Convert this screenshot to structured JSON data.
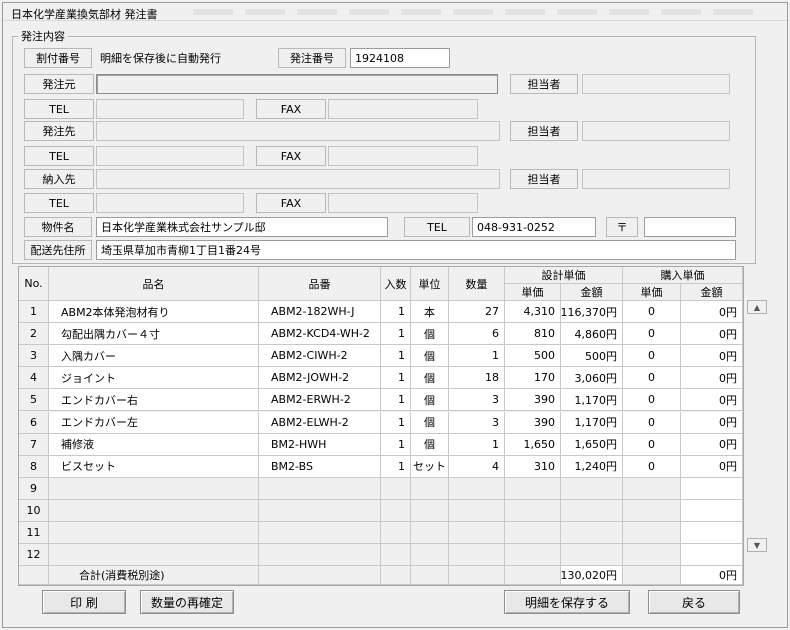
{
  "window": {
    "title": "日本化学産業換気部材 発注書"
  },
  "order_info": {
    "legend": "発注内容",
    "wari_no_label": "割付番号",
    "wari_no_value": "明細を保存後に自動発行",
    "order_no_label": "発注番号",
    "order_no_value": "1924108",
    "from_label": "発注元",
    "from_value": "",
    "from_person_label": "担当者",
    "from_person_value": "",
    "from_tel_label": "TEL",
    "from_tel_value": "",
    "from_fax_label": "FAX",
    "from_fax_value": "",
    "to_label": "発注先",
    "to_value": "",
    "to_person_label": "担当者",
    "to_person_value": "",
    "to_tel_label": "TEL",
    "to_tel_value": "",
    "to_fax_label": "FAX",
    "to_fax_value": "",
    "deliver_label": "納入先",
    "deliver_value": "",
    "deliver_person_label": "担当者",
    "deliver_person_value": "",
    "deliver_tel_label": "TEL",
    "deliver_tel_value": "",
    "deliver_fax_label": "FAX",
    "deliver_fax_value": "",
    "property_label": "物件名",
    "property_value": "日本化学産業株式会社サンプル邸",
    "property_tel_label": "TEL",
    "property_tel_value": "048-931-0252",
    "postal_label": "〒",
    "postal_value": "",
    "address_label": "配送先住所",
    "address_value": "埼玉県草加市青柳1丁目1番24号"
  },
  "table": {
    "headers": {
      "no": "No.",
      "name": "品名",
      "code": "品番",
      "qty_per": "入数",
      "unit": "単位",
      "qty": "数量",
      "design_price": "設計単価",
      "unit_price": "単価",
      "amount": "金額",
      "purchase_price": "購入単価",
      "p_unit_price": "単価",
      "p_amount": "金額"
    },
    "rows": [
      {
        "no": "1",
        "name": "ABM2本体発泡材有り",
        "code": "ABM2-182WH-J",
        "qty_per": "1",
        "unit": "本",
        "qty": "27",
        "price": "4,310",
        "amount": "116,370円",
        "p_price": "0",
        "p_amount": "0円"
      },
      {
        "no": "2",
        "name": "勾配出隅カバー４寸",
        "code": "ABM2-KCD4-WH-2",
        "qty_per": "1",
        "unit": "個",
        "qty": "6",
        "price": "810",
        "amount": "4,860円",
        "p_price": "0",
        "p_amount": "0円"
      },
      {
        "no": "3",
        "name": "入隅カバー",
        "code": "ABM2-CIWH-2",
        "qty_per": "1",
        "unit": "個",
        "qty": "1",
        "price": "500",
        "amount": "500円",
        "p_price": "0",
        "p_amount": "0円"
      },
      {
        "no": "4",
        "name": "ジョイント",
        "code": "ABM2-JOWH-2",
        "qty_per": "1",
        "unit": "個",
        "qty": "18",
        "price": "170",
        "amount": "3,060円",
        "p_price": "0",
        "p_amount": "0円"
      },
      {
        "no": "5",
        "name": "エンドカバー右",
        "code": "ABM2-ERWH-2",
        "qty_per": "1",
        "unit": "個",
        "qty": "3",
        "price": "390",
        "amount": "1,170円",
        "p_price": "0",
        "p_amount": "0円"
      },
      {
        "no": "6",
        "name": "エンドカバー左",
        "code": "ABM2-ELWH-2",
        "qty_per": "1",
        "unit": "個",
        "qty": "3",
        "price": "390",
        "amount": "1,170円",
        "p_price": "0",
        "p_amount": "0円"
      },
      {
        "no": "7",
        "name": "補修液",
        "code": "BM2-HWH",
        "qty_per": "1",
        "unit": "個",
        "qty": "1",
        "price": "1,650",
        "amount": "1,650円",
        "p_price": "0",
        "p_amount": "0円"
      },
      {
        "no": "8",
        "name": "ビスセット",
        "code": "BM2-BS",
        "qty_per": "1",
        "unit": "セット",
        "qty": "4",
        "price": "310",
        "amount": "1,240円",
        "p_price": "0",
        "p_amount": "0円"
      },
      {
        "no": "9",
        "name": "",
        "code": "",
        "qty_per": "",
        "unit": "",
        "qty": "",
        "price": "",
        "amount": "",
        "p_price": "",
        "p_amount": ""
      },
      {
        "no": "10",
        "name": "",
        "code": "",
        "qty_per": "",
        "unit": "",
        "qty": "",
        "price": "",
        "amount": "",
        "p_price": "",
        "p_amount": ""
      },
      {
        "no": "11",
        "name": "",
        "code": "",
        "qty_per": "",
        "unit": "",
        "qty": "",
        "price": "",
        "amount": "",
        "p_price": "",
        "p_amount": ""
      },
      {
        "no": "12",
        "name": "",
        "code": "",
        "qty_per": "",
        "unit": "",
        "qty": "",
        "price": "",
        "amount": "",
        "p_price": "",
        "p_amount": ""
      }
    ],
    "total": {
      "label": "合計(消費税別途)",
      "amount": "130,020円",
      "p_amount": "0円"
    }
  },
  "buttons": {
    "print": "印 刷",
    "reconfirm_qty": "数量の再確定",
    "save_details": "明細を保存する",
    "back": "戻る"
  },
  "icons": {
    "scroll_up": "scroll-up-arrow-icon",
    "scroll_down": "scroll-down-arrow-icon"
  }
}
